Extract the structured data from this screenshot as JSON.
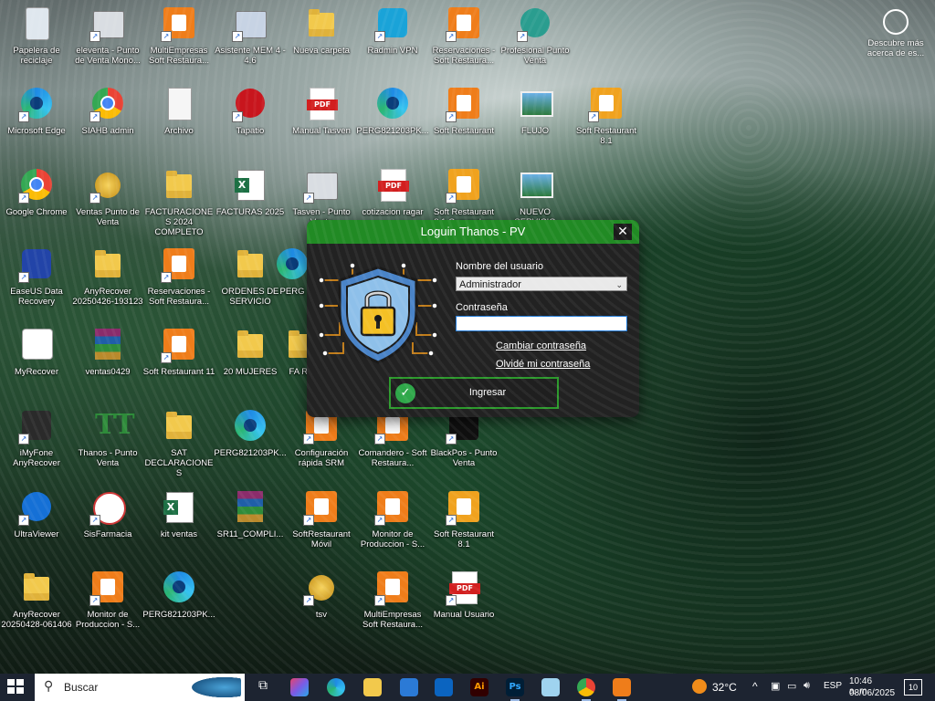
{
  "desktop": {
    "icons": [
      {
        "label": "Papelera de reciclaje",
        "icon": "recycle-bin-icon"
      },
      {
        "label": "eleventa - Punto de Venta Mono...",
        "icon": "cash-register-icon"
      },
      {
        "label": "MultiEmpresas Soft Restaura...",
        "icon": "multiempresas-icon"
      },
      {
        "label": "Asistente MEM 4 - 4.6",
        "icon": "assistant-icon"
      },
      {
        "label": "Nueva carpeta",
        "icon": "folder-icon"
      },
      {
        "label": "Radmin VPN",
        "icon": "radmin-vpn-icon"
      },
      {
        "label": "Reservaciones - Soft Restaura...",
        "icon": "reservations-icon"
      },
      {
        "label": "Profesional Punto Venta",
        "icon": "pos-icon"
      },
      {
        "label": "Microsoft Edge",
        "icon": "edge-icon"
      },
      {
        "label": "SIAHB admin",
        "icon": "chrome-icon"
      },
      {
        "label": "Archivo",
        "icon": "file-icon"
      },
      {
        "label": "Tapatio",
        "icon": "red-app-icon"
      },
      {
        "label": "Manual Tasven",
        "icon": "pdf-icon"
      },
      {
        "label": "PERG821203PK...",
        "icon": "edge-icon"
      },
      {
        "label": "Soft Restaurant",
        "icon": "soft-restaurant-icon"
      },
      {
        "label": "FLUJO",
        "icon": "image-icon"
      },
      {
        "label": "Soft Restaurant 8.1",
        "icon": "soft-restaurant-8-icon"
      },
      {
        "label": "Google Chrome",
        "icon": "chrome-icon"
      },
      {
        "label": "Ventas Punto de Venta",
        "icon": "coins-icon"
      },
      {
        "label": "FACTURACIONES 2024 COMPLETO",
        "icon": "folder-icon"
      },
      {
        "label": "FACTURAS 2025",
        "icon": "excel-icon"
      },
      {
        "label": "Tasven - Punto Venta",
        "icon": "cash-register-icon"
      },
      {
        "label": "cotizacion ragar",
        "icon": "pdf-icon"
      },
      {
        "label": "Soft Restaurant 8.1 Comandero",
        "icon": "soft-restaurant-comandero-icon"
      },
      {
        "label": "NUEVO SERVICIO",
        "icon": "image-icon"
      },
      {
        "label": "EaseUS Data Recovery",
        "icon": "data-recovery-icon"
      },
      {
        "label": "AnyRecover 20250426-193123",
        "icon": "folder-icon"
      },
      {
        "label": "Reservaciones - Soft Restaura...",
        "icon": "reservations-icon"
      },
      {
        "label": "ORDENES DE SERVICIO",
        "icon": "folder-icon"
      },
      {
        "label": "PERG",
        "icon": "edge-icon"
      },
      {
        "label": "MyRecover",
        "icon": "myrecover-icon"
      },
      {
        "label": "ventas0429",
        "icon": "winrar-icon"
      },
      {
        "label": "Soft Restaurant 11",
        "icon": "soft-restaurant-icon"
      },
      {
        "label": "20 MUJERES",
        "icon": "folder-icon"
      },
      {
        "label": "FA RA",
        "icon": "folder-icon"
      },
      {
        "label": "iMyFone AnyRecover",
        "icon": "anyrecover-icon"
      },
      {
        "label": "Thanos - Punto Venta",
        "icon": "thanos-icon"
      },
      {
        "label": "SAT DECLARACIONES",
        "icon": "folder-icon"
      },
      {
        "label": "PERG821203PK...",
        "icon": "edge-icon"
      },
      {
        "label": "Configuración rápida SRM",
        "icon": "srm-icon"
      },
      {
        "label": "Comandero - Soft Restaura...",
        "icon": "comandero-icon"
      },
      {
        "label": "BlackPos - Punto Venta",
        "icon": "blackpos-icon"
      },
      {
        "label": "UltraViewer",
        "icon": "ultraviewer-icon"
      },
      {
        "label": "SisFarmacia",
        "icon": "sisfarmacia-icon"
      },
      {
        "label": "kit ventas",
        "icon": "excel-icon"
      },
      {
        "label": "SR11_COMPLI...",
        "icon": "winrar-icon"
      },
      {
        "label": "SoftRestaurant Móvil",
        "icon": "srm-icon"
      },
      {
        "label": "Monitor de Produccion - S...",
        "icon": "monitor-icon"
      },
      {
        "label": "Soft Restaurant 8.1",
        "icon": "soft-restaurant-8-icon"
      },
      {
        "label": "AnyRecover 20250428-061406",
        "icon": "folder-icon"
      },
      {
        "label": "Monitor de Produccion - S...",
        "icon": "monitor-icon"
      },
      {
        "label": "PERG821203PK...",
        "icon": "edge-icon"
      },
      {
        "label": "tsv",
        "icon": "coins-icon"
      },
      {
        "label": "MultiEmpresas Soft Restaura...",
        "icon": "multiempresas-icon"
      },
      {
        "label": "Manual Usuario",
        "icon": "pdf-icon"
      }
    ],
    "learn_widget": {
      "label": "Descubre más acerca de es...",
      "icon": "learn-more-icon"
    }
  },
  "dialog": {
    "title": "Loguin Thanos - PV",
    "close_icon": "close-icon",
    "user_label": "Nombre del usuario",
    "user_value": "Administrador",
    "password_label": "Contraseña",
    "password_value": "",
    "change_password": "Cambiar contraseña",
    "forgot_password": "Olvidé mi contraseña",
    "login_button": "Ingresar",
    "illustration": "shield-lock-icon",
    "colors": {
      "titlebar": "#218a24",
      "body": "#222222",
      "accent": "#2c9a2c"
    }
  },
  "taskbar": {
    "search_placeholder": "Buscar",
    "apps": [
      "task-view-icon",
      "copilot-icon",
      "edge-icon",
      "file-explorer-icon",
      "store-icon",
      "outlook-icon",
      "illustrator-icon",
      "photoshop-icon",
      "notepad-icon",
      "chrome-icon",
      "soft-restaurant-icon"
    ],
    "temperature": "32°C",
    "language": "ESP",
    "time": "10:46 a. m.",
    "date": "08/06/2025",
    "notifications": "10"
  }
}
